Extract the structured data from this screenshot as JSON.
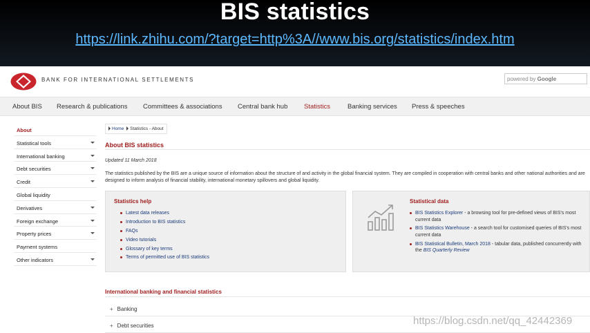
{
  "slide": {
    "title": "BIS statistics",
    "url": "https://link.zhihu.com/?target=http%3A//www.bis.org/statistics/index.htm"
  },
  "header": {
    "logo_text": "BANK FOR INTERNATIONAL SETTLEMENTS",
    "search_prefix": "powered by",
    "search_brand": "Google"
  },
  "nav": [
    {
      "label": "About BIS"
    },
    {
      "label": "Research & publications"
    },
    {
      "label": "Committees & associations"
    },
    {
      "label": "Central bank hub"
    },
    {
      "label": "Statistics",
      "active": true
    },
    {
      "label": "Banking services"
    },
    {
      "label": "Press & speeches"
    }
  ],
  "sidebar": [
    {
      "label": "About",
      "active": true
    },
    {
      "label": "Statistical tools",
      "caret": true
    },
    {
      "label": "International banking",
      "caret": true
    },
    {
      "label": "Debt securities",
      "caret": true
    },
    {
      "label": "Credit",
      "caret": true
    },
    {
      "label": "Global liquidity"
    },
    {
      "label": "Derivatives",
      "caret": true
    },
    {
      "label": "Foreign exchange",
      "caret": true
    },
    {
      "label": "Property prices",
      "caret": true
    },
    {
      "label": "Payment systems"
    },
    {
      "label": "Other indicators",
      "caret": true
    }
  ],
  "breadcrumb": {
    "home": "Home",
    "current": "Statistics - About"
  },
  "main": {
    "title": "About BIS statistics",
    "updated": "Updated 11 March 2018",
    "intro": "The statistics published by the BIS are a unique source of information about the structure of and activity in the global financial system. They are compiled in cooperation with central banks and other national authorities and are designed to inform analysis of financial stability, international monetary spillovers and global liquidity."
  },
  "help": {
    "title": "Statistics help",
    "links": [
      "Latest data releases",
      "Introduction to BIS statistics",
      "FAQs",
      "Video tutorials",
      "Glossary of key terms",
      "Terms of permitted use of BIS statistics"
    ]
  },
  "stat_data": {
    "title": "Statistical data",
    "items": [
      {
        "link": "BIS Statistics Explorer",
        "desc": " - a browsing tool for pre-defined views of BIS's most current data"
      },
      {
        "link": "BIS Statistics Warehouse",
        "desc": " - a search tool for customised queries of BIS's most current data"
      },
      {
        "link": "BIS Statistical Bulletin, March 2018",
        "desc": " - tabular data, published concurrently with the ",
        "link2": "BIS Quarterly Review"
      }
    ]
  },
  "section": {
    "title": "International banking and financial statistics",
    "accordions": [
      "Banking",
      "Debt securities"
    ]
  },
  "watermark": "https://blog.csdn.net/qq_42442369",
  "colors": {
    "accent": "#a01f1f",
    "link": "#1a3a7a",
    "url": "#5cb8ff"
  }
}
